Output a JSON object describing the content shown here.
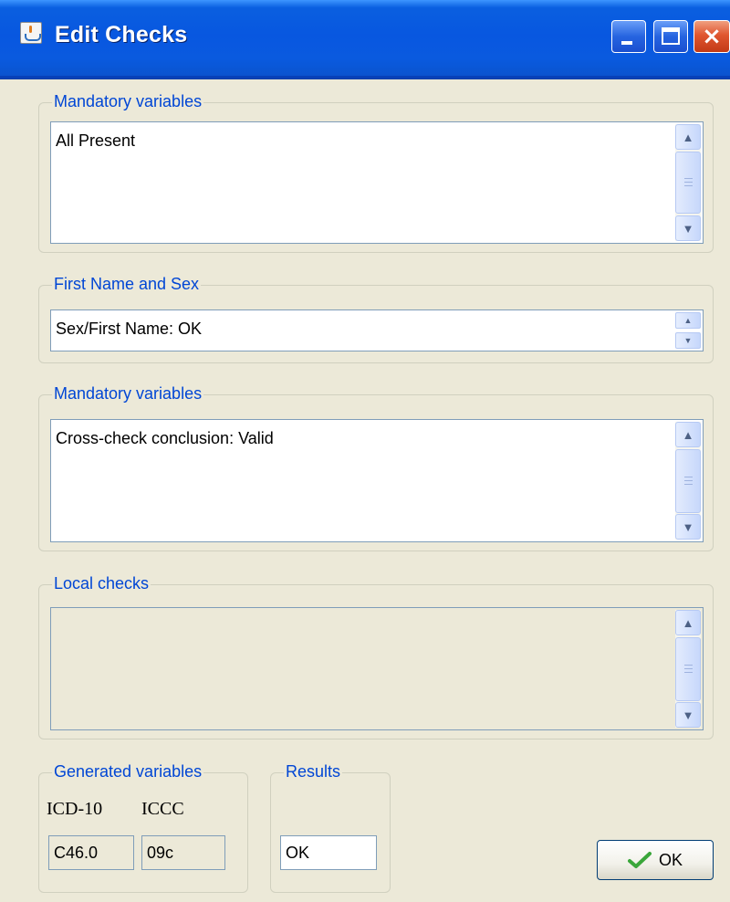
{
  "window": {
    "title": "Edit Checks",
    "controls": {
      "minimize": "minimize",
      "maximize": "maximize",
      "close": "×"
    }
  },
  "groups": {
    "mandatory_1": {
      "legend": "Mandatory variables",
      "text": "All Present"
    },
    "first_name_sex": {
      "legend": "First Name and Sex",
      "text": "Sex/First Name: OK"
    },
    "mandatory_2": {
      "legend": "Mandatory variables",
      "text": "Cross-check conclusion: Valid"
    },
    "local_checks": {
      "legend": "Local checks",
      "text": ""
    },
    "generated_variables": {
      "legend": "Generated variables",
      "icd10_label": "ICD-10",
      "iccc_label": "ICCC",
      "icd10_value": "C46.0",
      "iccc_value": "09c"
    },
    "results": {
      "legend": "Results",
      "value": "OK"
    }
  },
  "buttons": {
    "ok_label": "OK"
  },
  "icons": {
    "app": "java-app-icon",
    "scroll_up": "chevron-up-icon",
    "scroll_down": "chevron-down-icon",
    "ok": "checkmark-icon"
  },
  "colors": {
    "title_bar": "#0a5adf",
    "legend_text": "#0046d5",
    "window_bg": "#ece9d8",
    "check_green": "#3aa63a"
  }
}
